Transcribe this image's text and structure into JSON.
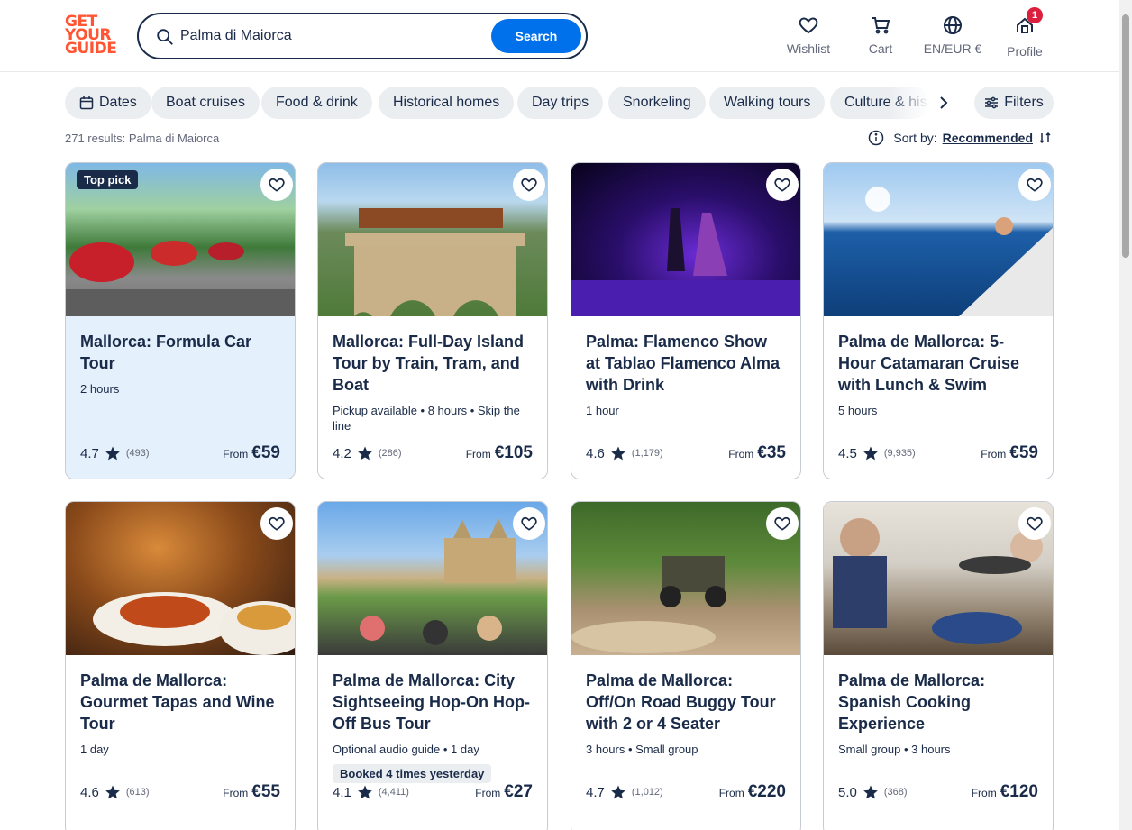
{
  "brand": {
    "logo_lines": [
      "GET",
      "YOUR",
      "GUIDE"
    ],
    "color": "#ff5533"
  },
  "search": {
    "value": "Palma di Maiorca",
    "button": "Search"
  },
  "nav": {
    "wishlist": "Wishlist",
    "cart": "Cart",
    "language": "EN/EUR €",
    "profile": "Profile",
    "profile_badge": "1"
  },
  "filters": {
    "chips": [
      "Dates",
      "Boat cruises",
      "Food & drink",
      "Historical homes",
      "Day trips",
      "Snorkeling",
      "Walking tours",
      "Culture & his"
    ],
    "filter_button": "Filters"
  },
  "results": {
    "count_text": "271 results: Palma di Maiorca",
    "sort_label": "Sort by:",
    "sort_value": "Recommended"
  },
  "cards": [
    {
      "title": "Mallorca: Formula Car Tour",
      "meta": "2 hours",
      "tag": "",
      "rating": "4.7",
      "reviews": "(493)",
      "from": "From",
      "price": "€59",
      "badge": "Top pick"
    },
    {
      "title": "Mallorca: Full-Day Island Tour by Train, Tram, and Boat",
      "meta": "Pickup available • 8 hours • Skip the line",
      "tag": "",
      "rating": "4.2",
      "reviews": "(286)",
      "from": "From",
      "price": "€105",
      "badge": ""
    },
    {
      "title": "Palma: Flamenco Show at Tablao Flamenco Alma with Drink",
      "meta": "1 hour",
      "tag": "",
      "rating": "4.6",
      "reviews": "(1,179)",
      "from": "From",
      "price": "€35",
      "badge": ""
    },
    {
      "title": "Palma de Mallorca: 5-Hour Catamaran Cruise with Lunch & Swim",
      "meta": "5 hours",
      "tag": "",
      "rating": "4.5",
      "reviews": "(9,935)",
      "from": "From",
      "price": "€59",
      "badge": ""
    },
    {
      "title": "Palma de Mallorca: Gourmet Tapas and Wine Tour",
      "meta": "1 day",
      "tag": "",
      "rating": "4.6",
      "reviews": "(613)",
      "from": "From",
      "price": "€55",
      "badge": ""
    },
    {
      "title": "Palma de Mallorca: City Sightseeing Hop-On Hop-Off Bus Tour",
      "meta": "Optional audio guide • 1 day",
      "tag": "Booked 4 times yesterday",
      "rating": "4.1",
      "reviews": "(4,411)",
      "from": "From",
      "price": "€27",
      "badge": ""
    },
    {
      "title": "Palma de Mallorca: Off/On Road Buggy Tour with 2 or 4 Seater",
      "meta": "3 hours • Small group",
      "tag": "",
      "rating": "4.7",
      "reviews": "(1,012)",
      "from": "From",
      "price": "€220",
      "badge": ""
    },
    {
      "title": "Palma de Mallorca: Spanish Cooking Experience",
      "meta": "Small group • 3 hours",
      "tag": "",
      "rating": "5.0",
      "reviews": "(368)",
      "from": "From",
      "price": "€120",
      "badge": ""
    }
  ]
}
